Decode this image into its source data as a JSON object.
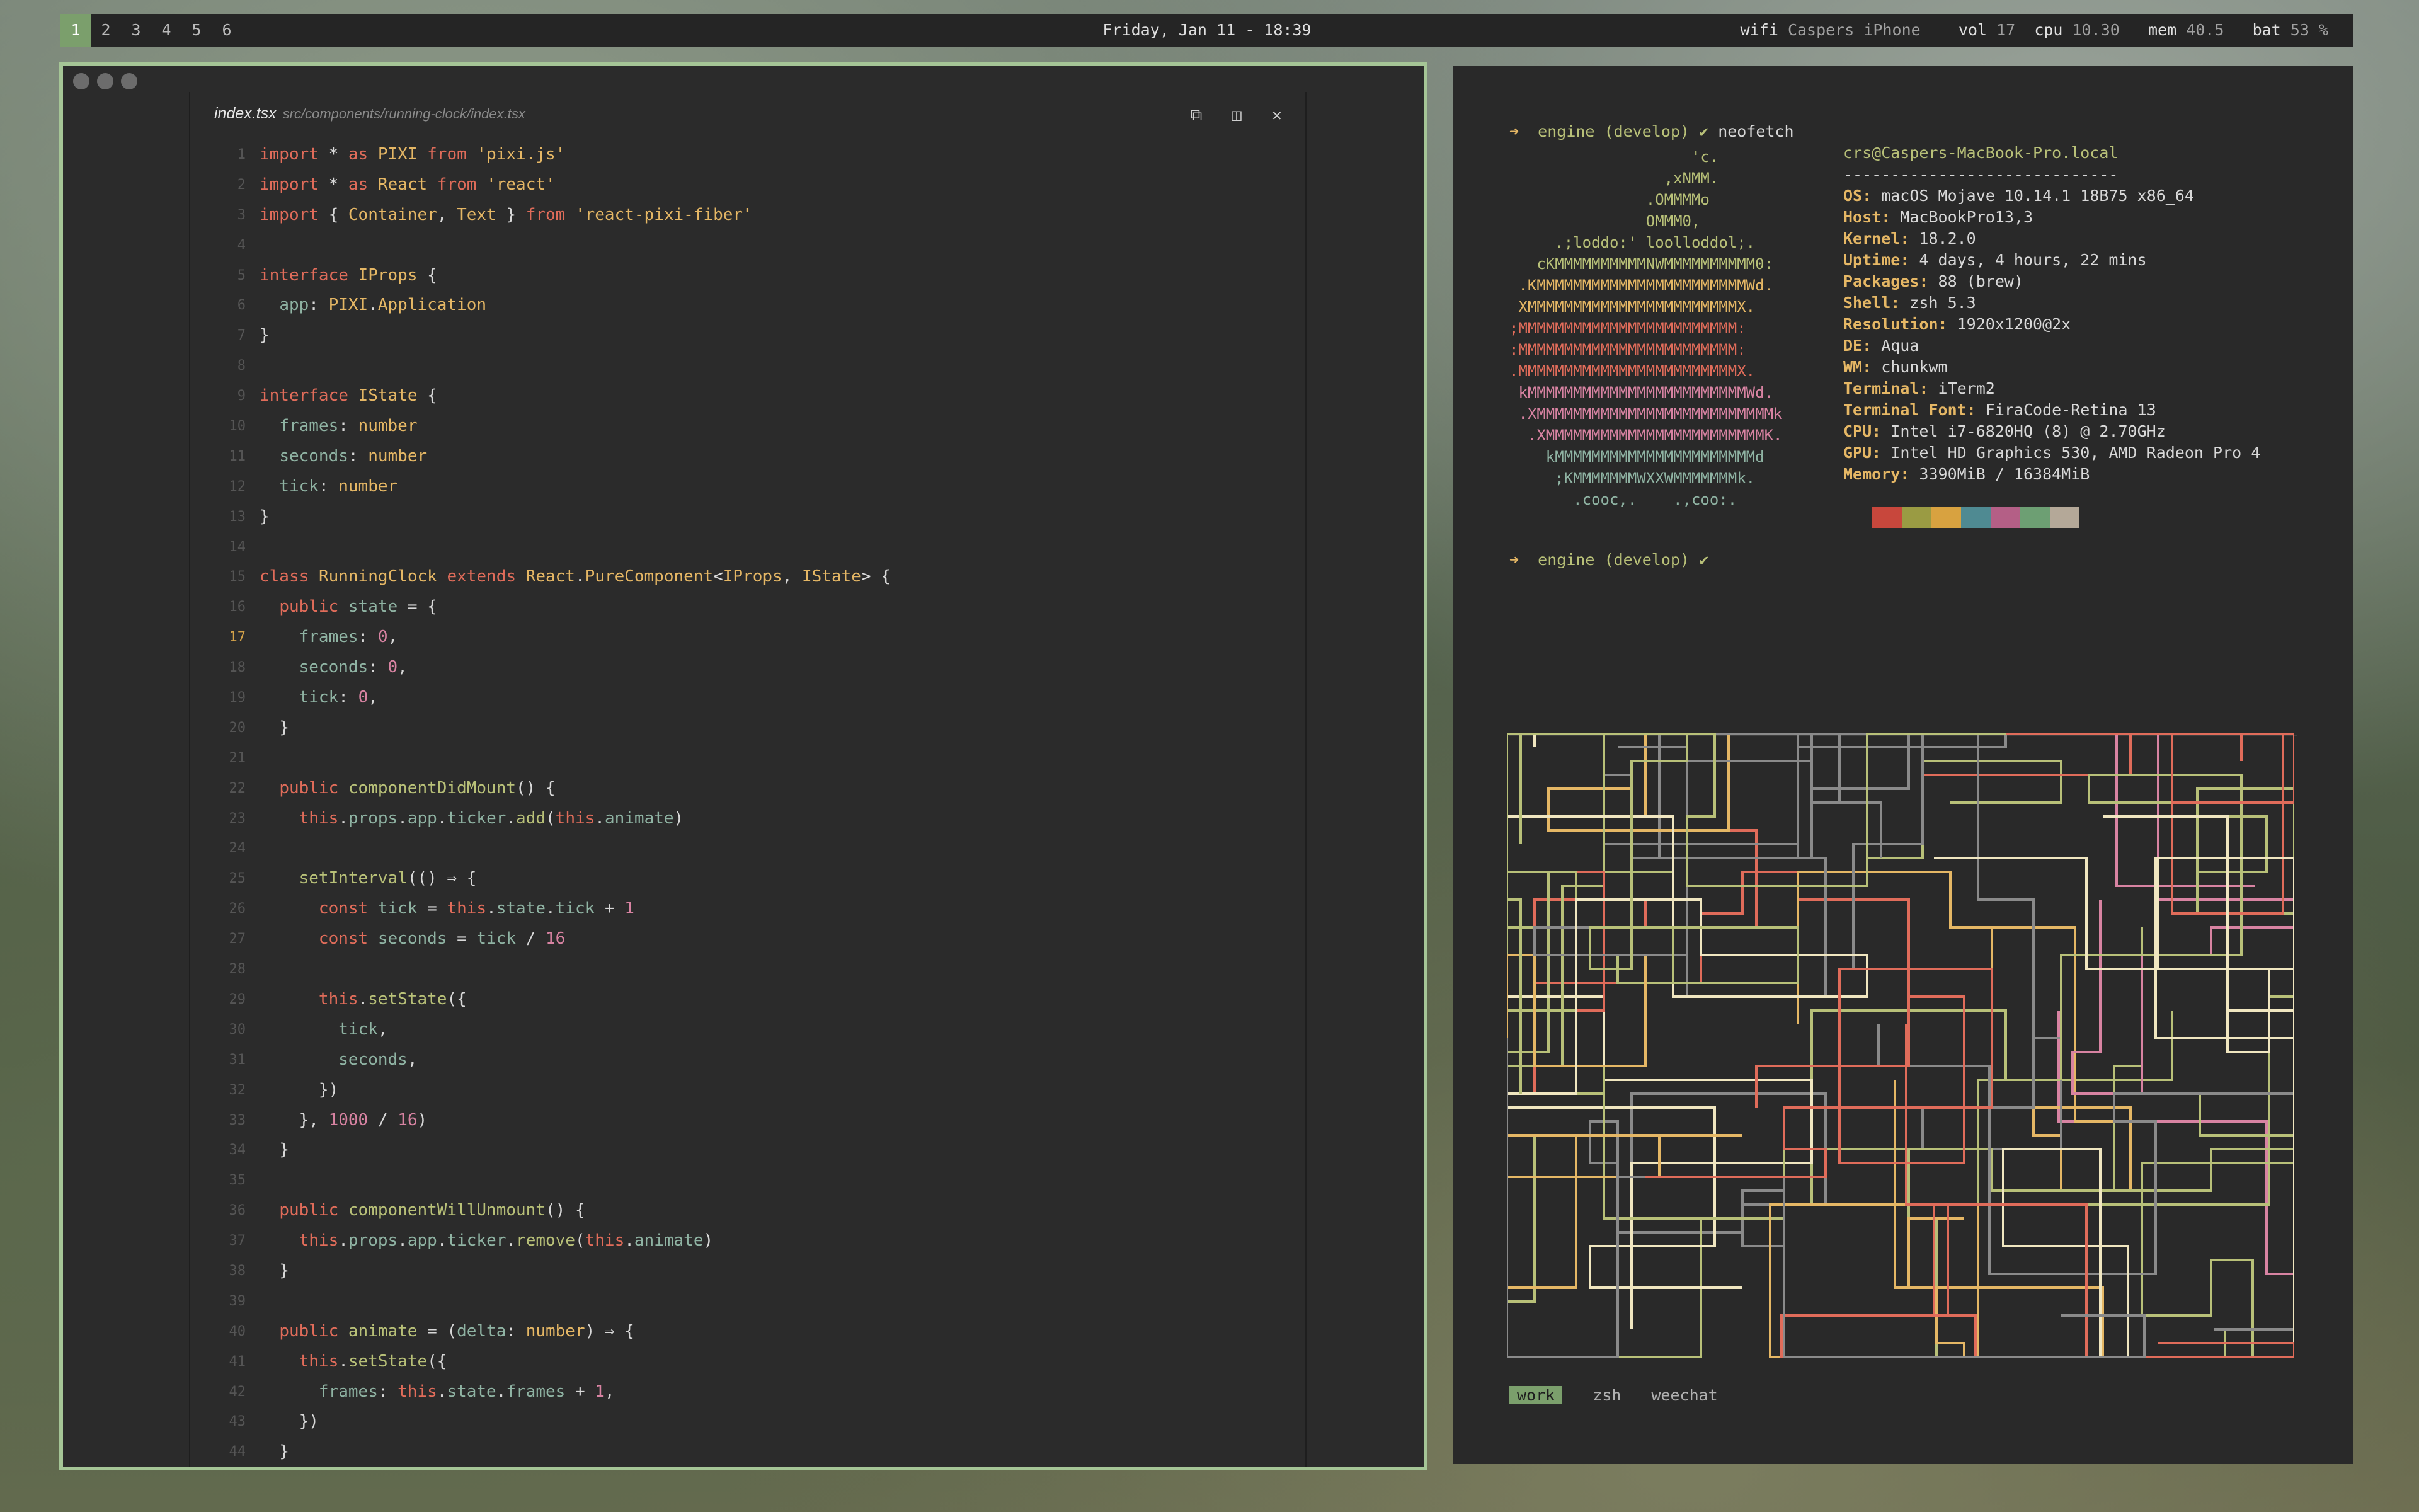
{
  "topbar": {
    "workspaces": [
      "1",
      "2",
      "3",
      "4",
      "5",
      "6"
    ],
    "active_workspace": "1",
    "clock": "Friday, Jan 11 - 18:39",
    "wifi_label": "wifi",
    "wifi_value": "Caspers iPhone",
    "vol_label": "vol",
    "vol_value": "17",
    "cpu_label": "cpu",
    "cpu_value": "10.30",
    "mem_label": "mem",
    "mem_value": "40.5",
    "bat_label": "bat",
    "bat_value": "53 %"
  },
  "editor": {
    "file_name": "index.tsx",
    "file_path": "src/components/running-clock/index.tsx",
    "current_line": 17,
    "icons": [
      "copy-icon",
      "split-icon",
      "close-icon"
    ],
    "lines": [
      "import * as PIXI from 'pixi.js'",
      "import * as React from 'react'",
      "import { Container, Text } from 'react-pixi-fiber'",
      "",
      "interface IProps {",
      "  app: PIXI.Application",
      "}",
      "",
      "interface IState {",
      "  frames: number",
      "  seconds: number",
      "  tick: number",
      "}",
      "",
      "class RunningClock extends React.PureComponent<IProps, IState> {",
      "  public state = {",
      "    frames: 0,",
      "    seconds: 0,",
      "    tick: 0,",
      "  }",
      "",
      "  public componentDidMount() {",
      "    this.props.app.ticker.add(this.animate)",
      "",
      "    setInterval(() ⇒ {",
      "      const tick = this.state.tick + 1",
      "      const seconds = tick / 16",
      "",
      "      this.setState({",
      "        tick,",
      "        seconds,",
      "      })",
      "    }, 1000 / 16)",
      "  }",
      "",
      "  public componentWillUnmount() {",
      "    this.props.app.ticker.remove(this.animate)",
      "  }",
      "",
      "  public animate = (delta: number) ⇒ {",
      "    this.setState({",
      "      frames: this.state.frames + 1,",
      "    })",
      "  }"
    ]
  },
  "terminal": {
    "prompt_dir": "engine",
    "prompt_branch": "(develop)",
    "prompt_check": "✔",
    "command": "neofetch",
    "user_host": "crs@Caspers-MacBook-Pro.local",
    "separator": "-----------------------------",
    "info": [
      {
        "label": "OS:",
        "value": "macOS Mojave 10.14.1 18B75 x86_64"
      },
      {
        "label": "Host:",
        "value": "MacBookPro13,3"
      },
      {
        "label": "Kernel:",
        "value": "18.2.0"
      },
      {
        "label": "Uptime:",
        "value": "4 days, 4 hours, 22 mins"
      },
      {
        "label": "Packages:",
        "value": "88 (brew)"
      },
      {
        "label": "Shell:",
        "value": "zsh 5.3"
      },
      {
        "label": "Resolution:",
        "value": "1920x1200@2x"
      },
      {
        "label": "DE:",
        "value": "Aqua"
      },
      {
        "label": "WM:",
        "value": "chunkwm"
      },
      {
        "label": "Terminal:",
        "value": "iTerm2"
      },
      {
        "label": "Terminal Font:",
        "value": "FiraCode-Retina 13"
      },
      {
        "label": "CPU:",
        "value": "Intel i7-6820HQ (8) @ 2.70GHz"
      },
      {
        "label": "GPU:",
        "value": "Intel HD Graphics 530, AMD Radeon Pro 4"
      },
      {
        "label": "Memory:",
        "value": "3390MiB / 16384MiB"
      }
    ],
    "ascii_logo": [
      {
        "text": "                    'c.",
        "color": "#b8c078"
      },
      {
        "text": "                 ,xNMM.",
        "color": "#b8c078"
      },
      {
        "text": "               .OMMMMo",
        "color": "#b8c078"
      },
      {
        "text": "               OMMM0,",
        "color": "#b8c078"
      },
      {
        "text": "     .;loddo:' loolloddol;.",
        "color": "#b8c078"
      },
      {
        "text": "   cKMMMMMMMMMMNWMMMMMMMMMM0:",
        "color": "#b8c078"
      },
      {
        "text": " .KMMMMMMMMMMMMMMMMMMMMMMMWd.",
        "color": "#e5b765"
      },
      {
        "text": " XMMMMMMMMMMMMMMMMMMMMMMMX.",
        "color": "#e5b765"
      },
      {
        "text": ";MMMMMMMMMMMMMMMMMMMMMMMM:",
        "color": "#e06c5a"
      },
      {
        "text": ":MMMMMMMMMMMMMMMMMMMMMMMM:",
        "color": "#e06c5a"
      },
      {
        "text": ".MMMMMMMMMMMMMMMMMMMMMMMMX.",
        "color": "#e06c5a"
      },
      {
        "text": " kMMMMMMMMMMMMMMMMMMMMMMMMWd.",
        "color": "#d883a2"
      },
      {
        "text": " .XMMMMMMMMMMMMMMMMMMMMMMMMMMk",
        "color": "#d883a2"
      },
      {
        "text": "  .XMMMMMMMMMMMMMMMMMMMMMMMMK.",
        "color": "#d883a2"
      },
      {
        "text": "    kMMMMMMMMMMMMMMMMMMMMMMd",
        "color": "#8fb3a3"
      },
      {
        "text": "     ;KMMMMMMMWXXWMMMMMMMk.",
        "color": "#8fb3a3"
      },
      {
        "text": "       .cooc,.    .,coo:.",
        "color": "#8fb3a3"
      }
    ],
    "palette": [
      "#c8473c",
      "#9a9b43",
      "#d8a240",
      "#4f8a92",
      "#b45f86",
      "#6d9f73",
      "#b4a898"
    ],
    "tmux_windows": [
      "work",
      "zsh",
      "weechat"
    ],
    "active_window": "work"
  }
}
